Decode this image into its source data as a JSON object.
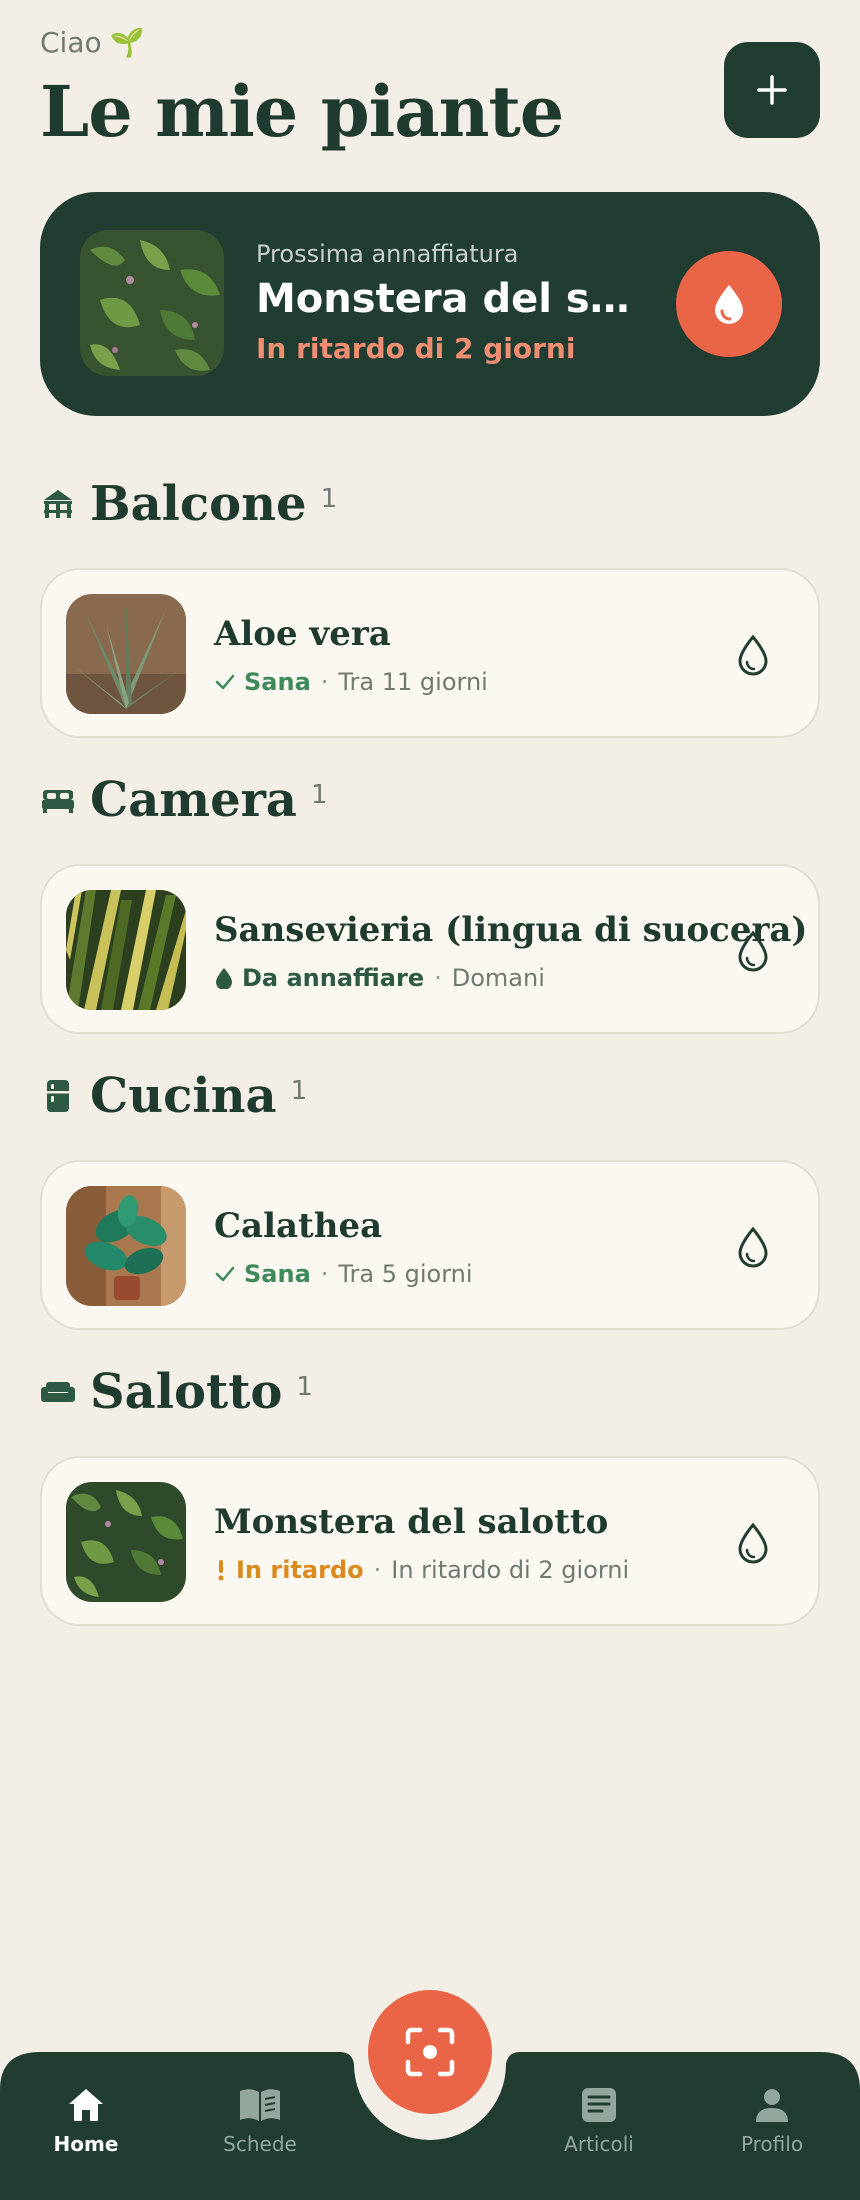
{
  "header": {
    "greeting": "Ciao",
    "greeting_emoji": "🌱",
    "title": "Le mie piante",
    "add_icon": "plus-icon"
  },
  "hero": {
    "label": "Prossima annaffiatura",
    "plant_name": "Monstera del salotto",
    "status": "In ritardo di 2 giorni",
    "action_icon": "water-drop-icon"
  },
  "sections": [
    {
      "name": "Balcone",
      "count": "1",
      "icon": "balcony-icon",
      "plant": {
        "name": "Aloe vera",
        "status": "Sana",
        "status_icon": "check-icon",
        "when": "Tra 11 giorni"
      }
    },
    {
      "name": "Camera",
      "count": "1",
      "icon": "bed-icon",
      "plant": {
        "name": "Sansevieria (lingua di suocera)",
        "status": "Da annaffiare",
        "status_icon": "drop-icon",
        "when": "Domani"
      }
    },
    {
      "name": "Cucina",
      "count": "1",
      "icon": "fridge-icon",
      "plant": {
        "name": "Calathea",
        "status": "Sana",
        "status_icon": "check-icon",
        "when": "Tra 5 giorni"
      }
    },
    {
      "name": "Salotto",
      "count": "1",
      "icon": "sofa-icon",
      "plant": {
        "name": "Monstera del salotto",
        "status": "In ritardo",
        "status_icon": "exclamation-icon",
        "when": "In ritardo di 2 giorni"
      }
    }
  ],
  "separator": "·",
  "nav": {
    "home": "Home",
    "schede": "Schede",
    "articoli": "Articoli",
    "profilo": "Profilo",
    "scan_icon": "scan-icon"
  },
  "colors": {
    "background": "#f3efe6",
    "primary_dark": "#213c31",
    "accent": "#ea6448",
    "healthy": "#3f8a5a",
    "overdue": "#d98b1f"
  }
}
